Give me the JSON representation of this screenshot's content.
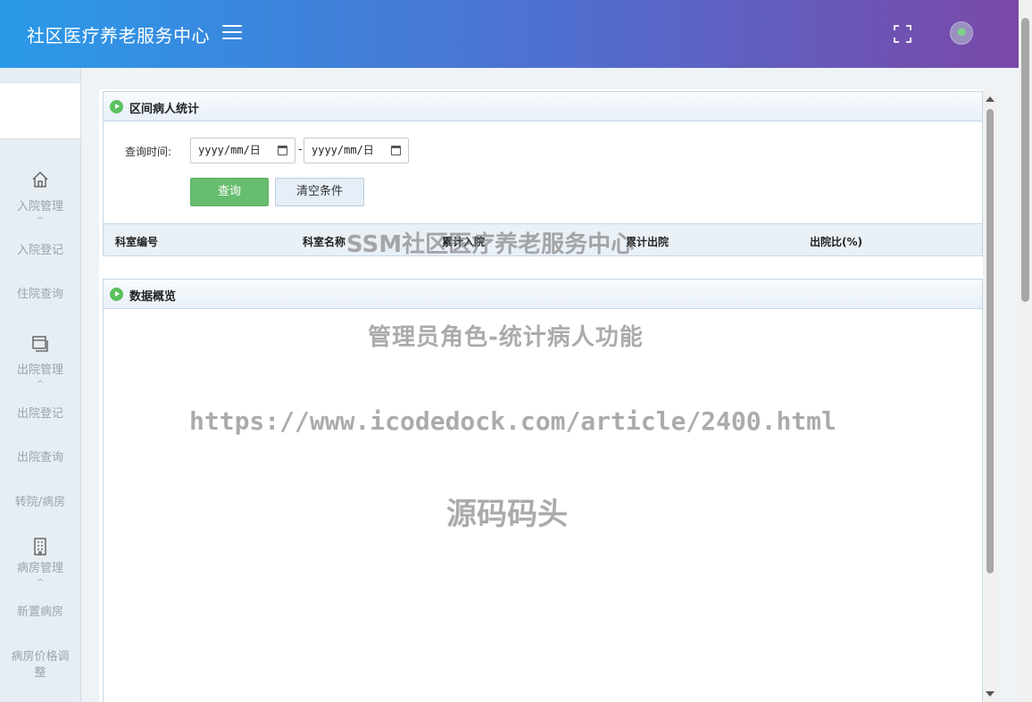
{
  "header": {
    "title": "社区医疗养老服务中心",
    "menu_icon": "hamburger-icon",
    "fullscreen_icon": "fullscreen-icon",
    "avatar_icon": "avatar"
  },
  "sidebar": {
    "groups": [
      {
        "icon": "home-icon",
        "label": "入院管理",
        "items": [
          "入院登记",
          "住院查询"
        ]
      },
      {
        "icon": "window-icon",
        "label": "出院管理",
        "items": [
          "出院登记",
          "出院查询",
          "转院/病房"
        ]
      },
      {
        "icon": "building-icon",
        "label": "病房管理",
        "items": [
          "新置病房",
          "病房价格调整"
        ]
      }
    ]
  },
  "stats_panel": {
    "title": "区间病人统计",
    "query_label": "查询时间:",
    "date_start_placeholder": "yyyy/mm/日",
    "date_end_placeholder": "yyyy/mm/日",
    "separator": "-",
    "query_button": "查询",
    "clear_button": "清空条件",
    "columns": [
      "科室编号",
      "科室名称",
      "累计入院",
      "累计出院",
      "出院比(%)"
    ]
  },
  "overview_panel": {
    "title": "数据概览"
  },
  "watermark": {
    "line1": "SSM社区医疗养老服务中心",
    "line2": "管理员角色-统计病人功能",
    "line3": "https://www.icodedock.com/article/2400.html",
    "line4": "源码码头"
  },
  "colors": {
    "header_start": "#2a9ae8",
    "header_end": "#7a48a8",
    "query_button": "#67bd6f",
    "panel_border": "#c5d7e6"
  }
}
